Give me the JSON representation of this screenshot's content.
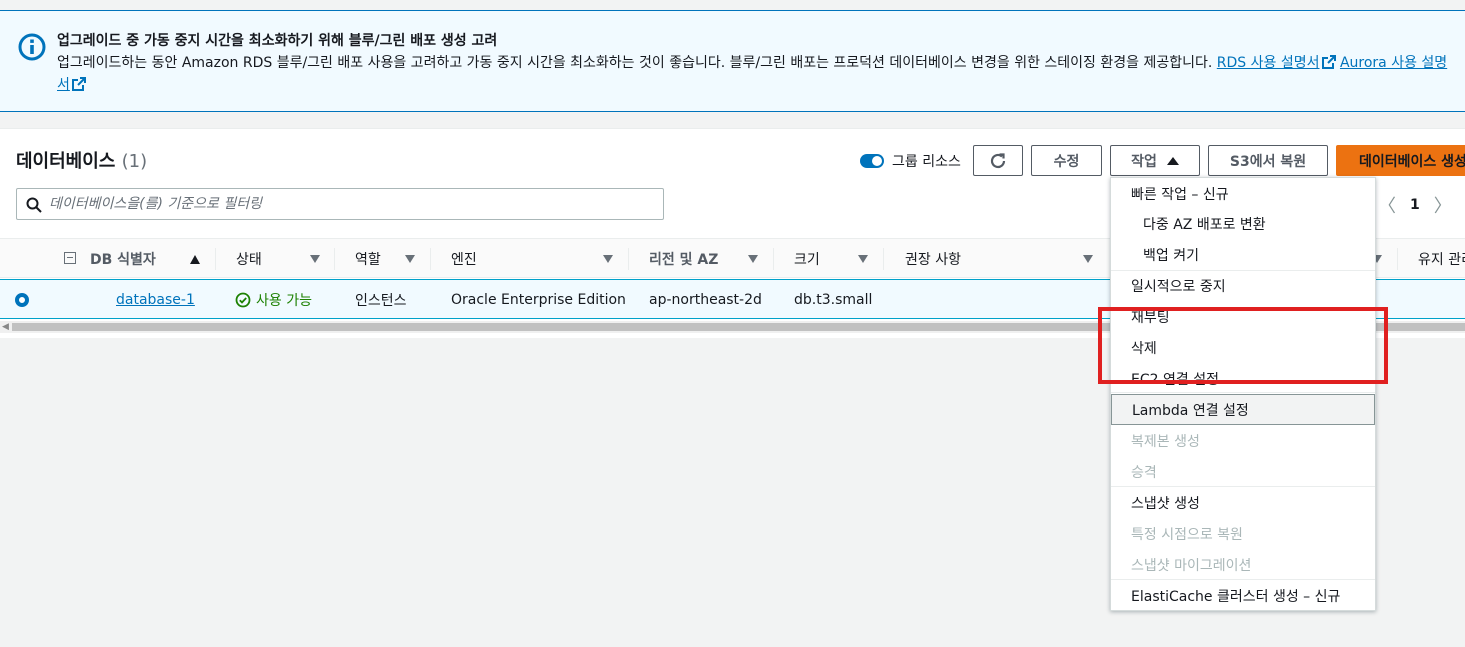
{
  "banner": {
    "title": "업그레이드 중 가동 중지 시간을 최소화하기 위해 블루/그린 배포 생성 고려",
    "body": "업그레이드하는 동안 Amazon RDS 블루/그린 배포 사용을 고려하고 가동 중지 시간을 최소화하는 것이 좋습니다. 블루/그린 배포는 프로덕션 데이터베이스 변경을 위한 스테이징 환경을 제공합니다.",
    "link_rds": "RDS 사용 설명서",
    "link_aurora": "Aurora 사용 설명서",
    "icon": "info-icon"
  },
  "panel": {
    "title": "데이터베이스",
    "count": "(1)",
    "group_resources_label": "그룹 리소스",
    "buttons": {
      "refresh_icon": "refresh-icon",
      "edit": "수정",
      "actions": "작업",
      "restore_s3": "S3에서 복원",
      "create": "데이터베이스 생성"
    },
    "filter_placeholder": "데이터베이스을(를) 기준으로 필터링",
    "page": "1"
  },
  "table": {
    "columns": [
      "DB 식별자",
      "상태",
      "역할",
      "엔진",
      "리전 및 AZ",
      "크기",
      "권장 사항",
      "유지 관리"
    ],
    "rows": [
      {
        "identifier": "database-1",
        "status": "사용 가능",
        "role": "인스턴스",
        "engine": "Oracle Enterprise Edition",
        "region": "ap-northeast-2d",
        "size": "db.t3.small"
      }
    ]
  },
  "actions_menu": {
    "quick_header": "빠른 작업 – 신규",
    "items": [
      "다중 AZ 배포로 변환",
      "백업 켜기",
      "일시적으로 중지",
      "재부팅",
      "삭제",
      "EC2 연결 설정",
      "Lambda 연결 설정",
      "복제본 생성",
      "승격",
      "스냅샷 생성",
      "특정 시점으로 복원",
      "스냅샷 마이그레이션",
      "ElastiCache 클러스터 생성 – 신규"
    ]
  },
  "colors": {
    "accent": "#0073bb",
    "primary_button": "#ec7211",
    "success": "#1d8102",
    "highlight": "#e02020"
  }
}
